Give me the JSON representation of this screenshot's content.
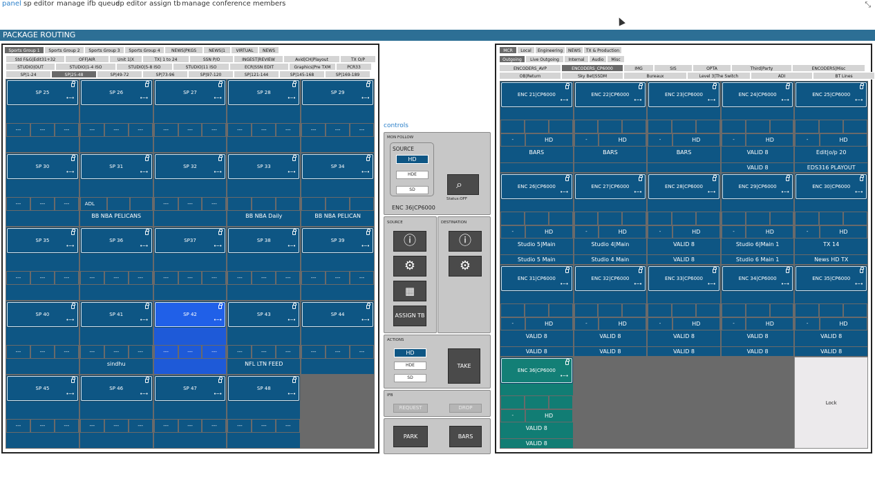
{
  "nav": {
    "items": [
      "panel",
      "sp editor",
      "manage ifb queue",
      "dp editor",
      "assign tb",
      "manage conference members"
    ]
  },
  "title": "PACKAGE ROUTING",
  "left": {
    "tabs1": [
      "Sports Group 1",
      "Sports Group 2",
      "Sports Group 3",
      "Sports Group 4",
      "NEWS|PKGS",
      "NEWS|1",
      "VIRTUAL",
      "NEWS"
    ],
    "tabs2": [
      "Std F&G|Edit31+32",
      "OFF|AIR",
      "Unit 1|X",
      "TX| 1 to 24",
      "SSN P/O",
      "INGEST|REVIEW",
      "Avid|CH|Playout",
      "TX O/P"
    ],
    "tabs3": [
      "STUDIO|OUT",
      "STUDIO|1-4 ISO",
      "STUDIO|5-8 ISO",
      "STUDIO|11 ISO",
      "ECR|SSN EDIT",
      "Graphics|Pre TXM",
      "PCR33"
    ],
    "tabs4": [
      "SP|1-24",
      "SP|25-48",
      "SP|49-72",
      "SP|73-96",
      "SP|97-120",
      "SP|121-144",
      "SP|145-168",
      "SP|169-189"
    ],
    "cells": [
      {
        "name": "SP 25",
        "dashes": [
          "---",
          "---",
          "---"
        ],
        "l1": "",
        "l2": ""
      },
      {
        "name": "SP 26",
        "dashes": [
          "---",
          "---",
          "---"
        ],
        "l1": "",
        "l2": ""
      },
      {
        "name": "SP 27",
        "dashes": [
          "---",
          "---",
          "---"
        ],
        "l1": "",
        "l2": ""
      },
      {
        "name": "SP 28",
        "dashes": [
          "---",
          "---",
          "---"
        ],
        "l1": "",
        "l2": ""
      },
      {
        "name": "SP 29",
        "dashes": [
          "---",
          "---",
          "---"
        ],
        "l1": "",
        "l2": ""
      },
      {
        "name": "SP 30",
        "dashes": [
          "---",
          "---",
          "---"
        ],
        "l1": "",
        "l2": ""
      },
      {
        "name": "SP 31",
        "dashes": [
          "ADL",
          "",
          ""
        ],
        "l1": "BB NBA PELICANS",
        "l2": ""
      },
      {
        "name": "SP 32",
        "dashes": [
          "---",
          "---",
          "---"
        ],
        "l1": "",
        "l2": ""
      },
      {
        "name": "SP 33",
        "dashes": [
          "",
          "",
          ""
        ],
        "l1": "BB NBA Daily",
        "l2": ""
      },
      {
        "name": "SP 34",
        "dashes": [
          "",
          "",
          ""
        ],
        "l1": "BB NBA PELICAN",
        "l2": ""
      },
      {
        "name": "SP 35",
        "dashes": [
          "---",
          "---",
          "---"
        ],
        "l1": "",
        "l2": ""
      },
      {
        "name": "SP 36",
        "dashes": [
          "---",
          "---",
          "---"
        ],
        "l1": "",
        "l2": ""
      },
      {
        "name": "SP37",
        "dashes": [
          "---",
          "---",
          "---"
        ],
        "l1": "",
        "l2": ""
      },
      {
        "name": "SP 38",
        "dashes": [
          "---",
          "---",
          "---"
        ],
        "l1": "",
        "l2": ""
      },
      {
        "name": "SP 39",
        "dashes": [
          "---",
          "---",
          "---"
        ],
        "l1": "",
        "l2": ""
      },
      {
        "name": "SP 40",
        "dashes": [
          "---",
          "---",
          "---"
        ],
        "l1": "",
        "l2": ""
      },
      {
        "name": "SP 41",
        "dashes": [
          "---",
          "---",
          "---"
        ],
        "l1": "sindhu",
        "l2": ""
      },
      {
        "name": "SP 42",
        "dashes": [
          "---",
          "---",
          "---"
        ],
        "l1": "",
        "l2": ""
      },
      {
        "name": "SP 43",
        "dashes": [
          "---",
          "---",
          "---"
        ],
        "l1": "NFL LTN FEED",
        "l2": ""
      },
      {
        "name": "SP 44",
        "dashes": [
          "---",
          "---",
          "---"
        ],
        "l1": "",
        "l2": ""
      },
      {
        "name": "SP 45",
        "dashes": [
          "---",
          "---",
          "---"
        ],
        "l1": "",
        "l2": ""
      },
      {
        "name": "SP 46",
        "dashes": [
          "---",
          "---",
          "---"
        ],
        "l1": "",
        "l2": ""
      },
      {
        "name": "SP 47",
        "dashes": [
          "---",
          "---",
          "---"
        ],
        "l1": "",
        "l2": ""
      },
      {
        "name": "SP 48",
        "dashes": [
          "---",
          "---",
          "---"
        ],
        "l1": "",
        "l2": ""
      }
    ]
  },
  "controls": {
    "label": "controls",
    "mon_follow": "MON FOLLOW",
    "source": "SOURCE",
    "hd": "HD",
    "hde": "HDE",
    "sd": "SD",
    "status": "Status:OFF",
    "device": "ENC 36|CP6000",
    "source_hdr": "SOURCE",
    "dest_hdr": "DESTINATION",
    "assign_tb": "ASSIGN TB",
    "actions": "ACTIONS",
    "take": "TAKE",
    "ifb": "IFB",
    "request": "REQUEST",
    "drop": "DROP",
    "park": "PARK",
    "bars": "BARS"
  },
  "right": {
    "tabs1": [
      "MCR",
      "Local",
      "Engineering",
      "NEWS",
      "TX & Production"
    ],
    "tabs2": [
      "Outgoing",
      "Live Outgoing",
      "Internal",
      "Audio",
      "Misc"
    ],
    "tabs3": [
      "ENCODERS_AVP",
      "ENCODERS_CP6000",
      "IMG",
      "SIS",
      "OPTA",
      "Third|Party",
      "ENCODERS|Misc"
    ],
    "tabs4": [
      "OB|Return",
      "Sky Bet|SSDM",
      "Bureaux",
      "Level 3|The Switch",
      "ADI",
      "BT Lines"
    ],
    "cells": [
      {
        "name": "ENC 21|CP6000",
        "l1": "BARS",
        "l2": ""
      },
      {
        "name": "ENC 22|CP6000",
        "l1": "BARS",
        "l2": ""
      },
      {
        "name": "ENC 23|CP6000",
        "l1": "BARS",
        "l2": ""
      },
      {
        "name": "ENC 24|CP6000",
        "l1": "VALID 8",
        "l2": "VALID 8"
      },
      {
        "name": "ENC 25|CP6000",
        "l1": "Edit|o/p 20",
        "l2": "EDS316 PLAYOUT"
      },
      {
        "name": "ENC 26|CP6000",
        "l1": "Studio 5|Main",
        "l2": "Studio 5 Main"
      },
      {
        "name": "ENC 27|CP6000",
        "l1": "Studio 4|Main",
        "l2": "Studio 4 Main"
      },
      {
        "name": "ENC 28|CP6000",
        "l1": "VALID 8",
        "l2": "VALID 8"
      },
      {
        "name": "ENC 29|CP6000",
        "l1": "Studio 6|Main 1",
        "l2": "Studio 6 Main 1"
      },
      {
        "name": "ENC 30|CP6000",
        "l1": "TX 14",
        "l2": "News HD TX"
      },
      {
        "name": "ENC 31|CP6000",
        "l1": "VALID 8",
        "l2": "VALID 8"
      },
      {
        "name": "ENC 32|CP6000",
        "l1": "VALID 8",
        "l2": "VALID 8"
      },
      {
        "name": "ENC 33|CP6000",
        "l1": "VALID 8",
        "l2": "VALID 8"
      },
      {
        "name": "ENC 34|CP6000",
        "l1": "VALID 8",
        "l2": "VALID 8"
      },
      {
        "name": "ENC 35|CP6000",
        "l1": "VALID 8",
        "l2": "VALID 8"
      },
      {
        "name": "ENC 36|CP6000",
        "l1": "VALID 8",
        "l2": "VALID 8"
      }
    ],
    "dash": "-",
    "hd": "HD",
    "lock": "Lock"
  }
}
